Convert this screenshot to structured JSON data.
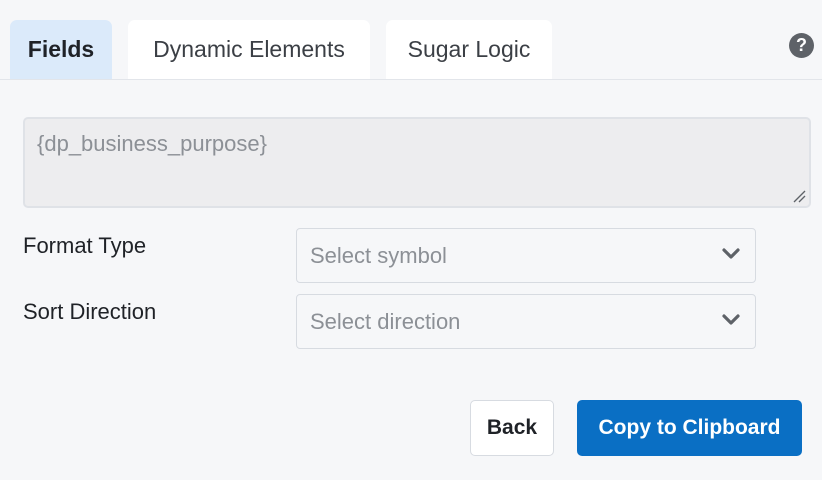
{
  "tabs": [
    {
      "label": "Fields",
      "active": true
    },
    {
      "label": "Dynamic Elements",
      "active": false
    },
    {
      "label": "Sugar Logic",
      "active": false
    }
  ],
  "help": {
    "icon": "help-circle-icon",
    "glyph": "?"
  },
  "field_area": {
    "value": "{dp_business_purpose}"
  },
  "form": {
    "format_type": {
      "label": "Format Type",
      "placeholder": "Select symbol"
    },
    "sort_direction": {
      "label": "Sort Direction",
      "placeholder": "Select direction"
    }
  },
  "buttons": {
    "back": "Back",
    "copy": "Copy to Clipboard"
  },
  "colors": {
    "accent": "#0a6fc4",
    "active_tab_bg": "#dbeafa",
    "page_bg": "#f6f7f9"
  }
}
